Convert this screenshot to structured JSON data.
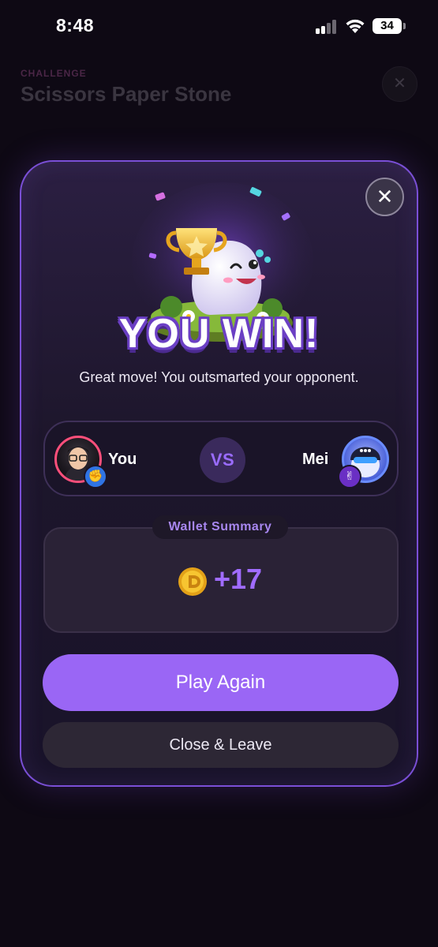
{
  "status_bar": {
    "time": "8:48",
    "battery": "34"
  },
  "background": {
    "kicker": "CHALLENGE",
    "title": "Scissors Paper Stone",
    "close_glyph": "✕"
  },
  "modal": {
    "close_glyph": "✕",
    "title": "YOU WIN!",
    "subtitle": "Great move! You outsmarted your opponent."
  },
  "match": {
    "player": {
      "name": "You",
      "move_icon": "hand-icon"
    },
    "vs_label": "VS",
    "opponent": {
      "name": "Mei",
      "move_icon": "scissors-hand-icon"
    }
  },
  "wallet": {
    "label": "Wallet Summary",
    "amount": "+17",
    "icon": "coin-icon"
  },
  "actions": {
    "play_again": "Play Again",
    "close_leave": "Close & Leave"
  },
  "colors": {
    "accent": "#9a66f5",
    "modal_border": "#7a4fd6",
    "player_ring": "#ff4f7b",
    "opponent_ring": "#6a8cff"
  }
}
